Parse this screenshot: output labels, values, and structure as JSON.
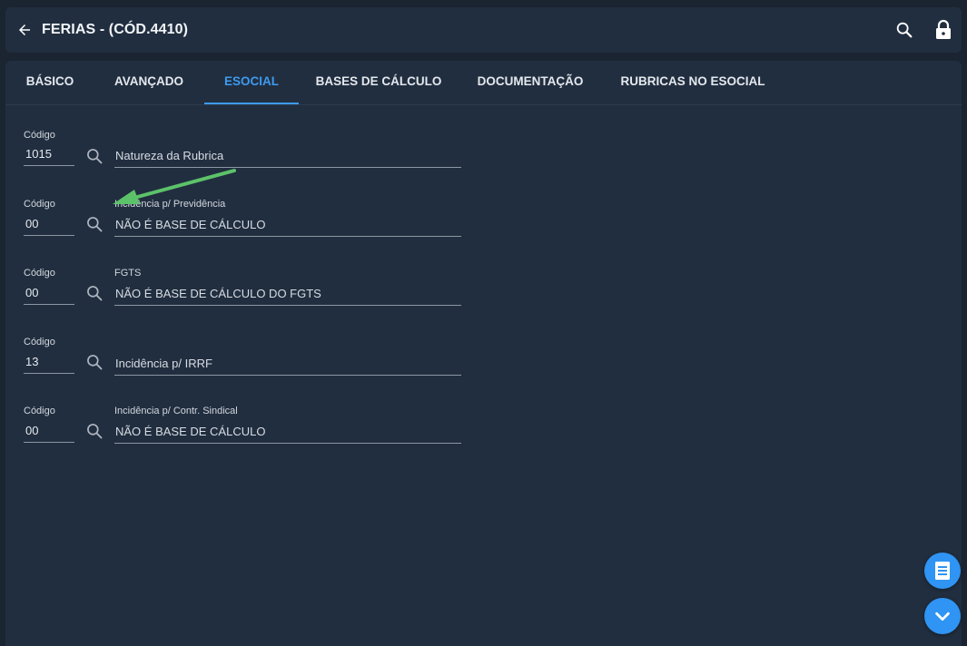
{
  "header": {
    "title": "FERIAS - (CÓD.4410)",
    "icons": [
      "arrow-left-icon",
      "search-icon",
      "lock-icon"
    ]
  },
  "tabs": [
    {
      "label": "BÁSICO",
      "active": false
    },
    {
      "label": "AVANÇADO",
      "active": false
    },
    {
      "label": "ESOCIAL",
      "active": true
    },
    {
      "label": "BASES DE CÁLCULO",
      "active": false
    },
    {
      "label": "DOCUMENTAÇÃO",
      "active": false
    },
    {
      "label": "RUBRICAS NO ESOCIAL",
      "active": false
    }
  ],
  "fields": [
    {
      "code_label": "Código",
      "code": "1015",
      "desc_label": "",
      "desc": "Natureza da Rubrica"
    },
    {
      "code_label": "Código",
      "code": "00",
      "desc_label": "Incidência p/ Previdência",
      "desc": "NÃO É BASE DE CÁLCULO"
    },
    {
      "code_label": "Código",
      "code": "00",
      "desc_label": "FGTS",
      "desc": "NÃO É BASE DE CÁLCULO DO FGTS"
    },
    {
      "code_label": "Código",
      "code": "13",
      "desc_label": "",
      "desc": "Incidência p/ IRRF"
    },
    {
      "code_label": "Código",
      "code": "00",
      "desc_label": "Incidência p/ Contr. Sindical",
      "desc": "NÃO É BASE DE CÁLCULO"
    }
  ],
  "colors": {
    "background": "#1b2431",
    "panel": "#212e3f",
    "accent": "#3d9bf0",
    "fab": "#2f94f3",
    "annotation_arrow": "#5cc26a"
  },
  "fabs": [
    "list-icon",
    "chevron-down-icon"
  ]
}
